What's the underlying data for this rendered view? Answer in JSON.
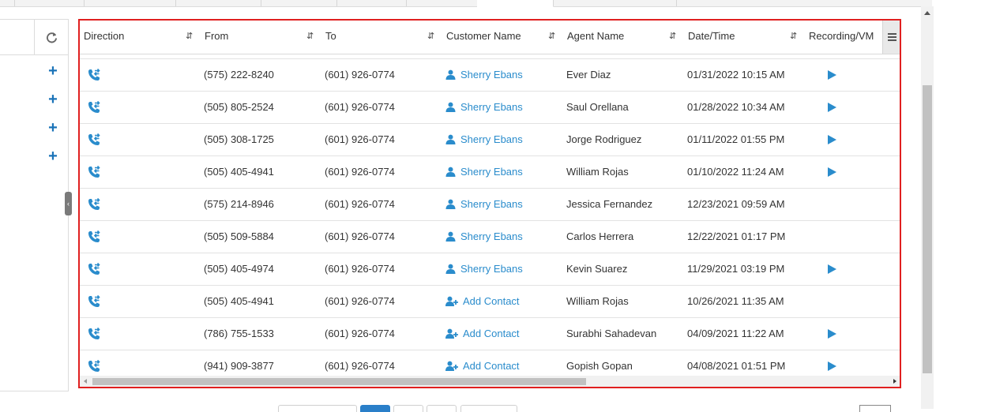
{
  "left_panel": {
    "refresh_icon": "refresh-icon",
    "add_buttons": [
      "+",
      "+",
      "+",
      "+"
    ]
  },
  "grid": {
    "columns": [
      "Direction",
      "From",
      "To",
      "Customer Name",
      "Agent Name",
      "Date/Time",
      "Recording/VM"
    ],
    "rows": [
      {
        "from": "(575) 222-8240",
        "to": "(601) 926-0774",
        "customer": "Sherry Ebans",
        "customer_type": "contact",
        "agent": "Ever Diaz",
        "datetime": "01/31/2022 10:15 AM",
        "recording": true
      },
      {
        "from": "(505) 805-2524",
        "to": "(601) 926-0774",
        "customer": "Sherry Ebans",
        "customer_type": "contact",
        "agent": "Saul Orellana",
        "datetime": "01/28/2022 10:34 AM",
        "recording": true
      },
      {
        "from": "(505) 308-1725",
        "to": "(601) 926-0774",
        "customer": "Sherry Ebans",
        "customer_type": "contact",
        "agent": "Jorge Rodriguez",
        "datetime": "01/11/2022 01:55 PM",
        "recording": true
      },
      {
        "from": "(505) 405-4941",
        "to": "(601) 926-0774",
        "customer": "Sherry Ebans",
        "customer_type": "contact",
        "agent": "William Rojas",
        "datetime": "01/10/2022 11:24 AM",
        "recording": true
      },
      {
        "from": "(575) 214-8946",
        "to": "(601) 926-0774",
        "customer": "Sherry Ebans",
        "customer_type": "contact",
        "agent": "Jessica Fernandez",
        "datetime": "12/23/2021 09:59 AM",
        "recording": false
      },
      {
        "from": "(505) 509-5884",
        "to": "(601) 926-0774",
        "customer": "Sherry Ebans",
        "customer_type": "contact",
        "agent": "Carlos Herrera",
        "datetime": "12/22/2021 01:17 PM",
        "recording": false
      },
      {
        "from": "(505) 405-4974",
        "to": "(601) 926-0774",
        "customer": "Sherry Ebans",
        "customer_type": "contact",
        "agent": "Kevin Suarez",
        "datetime": "11/29/2021 03:19 PM",
        "recording": true
      },
      {
        "from": "(505) 405-4941",
        "to": "(601) 926-0774",
        "customer": "Add Contact",
        "customer_type": "add",
        "agent": "William Rojas",
        "datetime": "10/26/2021 11:35 AM",
        "recording": false
      },
      {
        "from": "(786) 755-1533",
        "to": "(601) 926-0774",
        "customer": "Add Contact",
        "customer_type": "add",
        "agent": "Surabhi Sahadevan",
        "datetime": "04/09/2021 11:22 AM",
        "recording": true
      },
      {
        "from": "(941) 909-3877",
        "to": "(601) 926-0774",
        "customer": "Add Contact",
        "customer_type": "add",
        "agent": "Gopish Gopan",
        "datetime": "04/08/2021 01:51 PM",
        "recording": true
      }
    ]
  },
  "colors": {
    "accent": "#2a8ccc",
    "highlight_border": "#e02020",
    "plus": "#1a73b8"
  }
}
